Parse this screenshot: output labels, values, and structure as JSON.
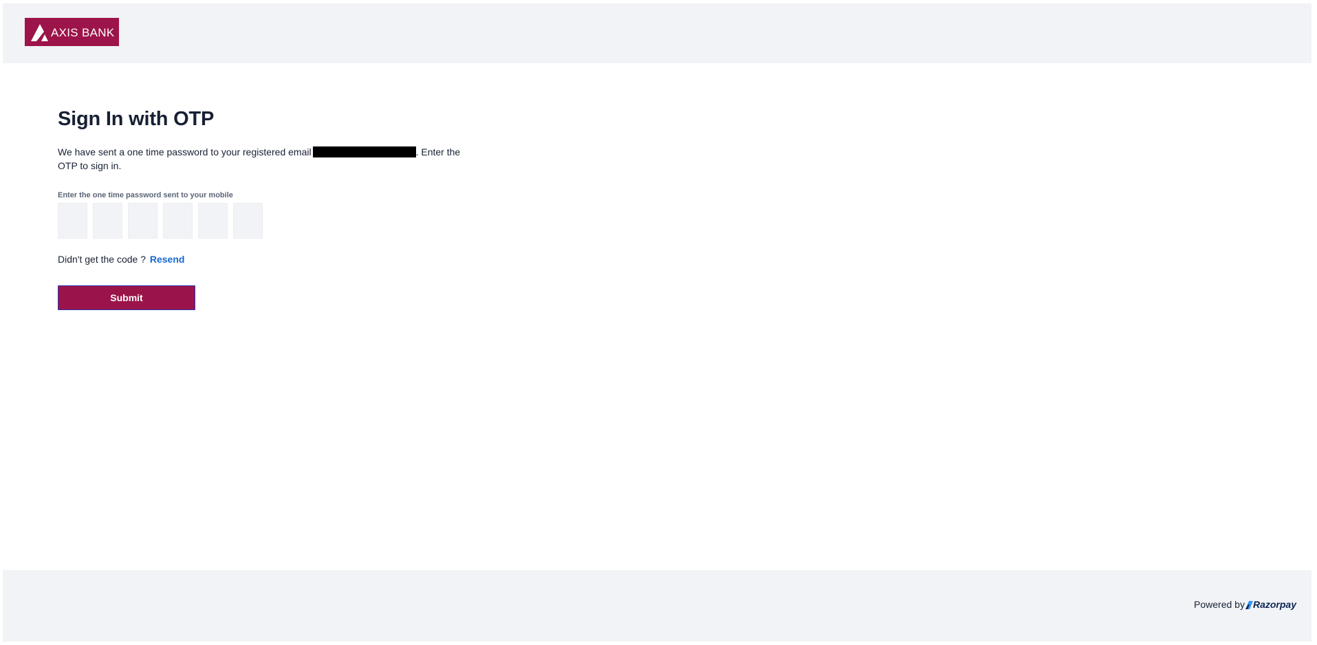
{
  "header": {
    "logo": {
      "text": "AXIS BANK",
      "icon": "axis-bank-logo-icon",
      "brand_color": "#9c1449"
    }
  },
  "main": {
    "title": "Sign In with OTP",
    "description_before": "We have sent a one time password to your registered email",
    "description_after": ". Enter the OTP to sign in.",
    "otp_label": "Enter the one time password sent to your mobile",
    "otp_digits": [
      "",
      "",
      "",
      "",
      "",
      ""
    ],
    "resend_prompt": "Didn't get the code ?",
    "resend_label": "Resend",
    "submit_label": "Submit"
  },
  "footer": {
    "powered_by": "Powered by",
    "provider": "Razorpay",
    "provider_icon": "razorpay-logo-icon"
  },
  "colors": {
    "accent": "#9a1449",
    "link": "#1569d2",
    "surface": "#f2f3f6",
    "text": "#172033"
  }
}
